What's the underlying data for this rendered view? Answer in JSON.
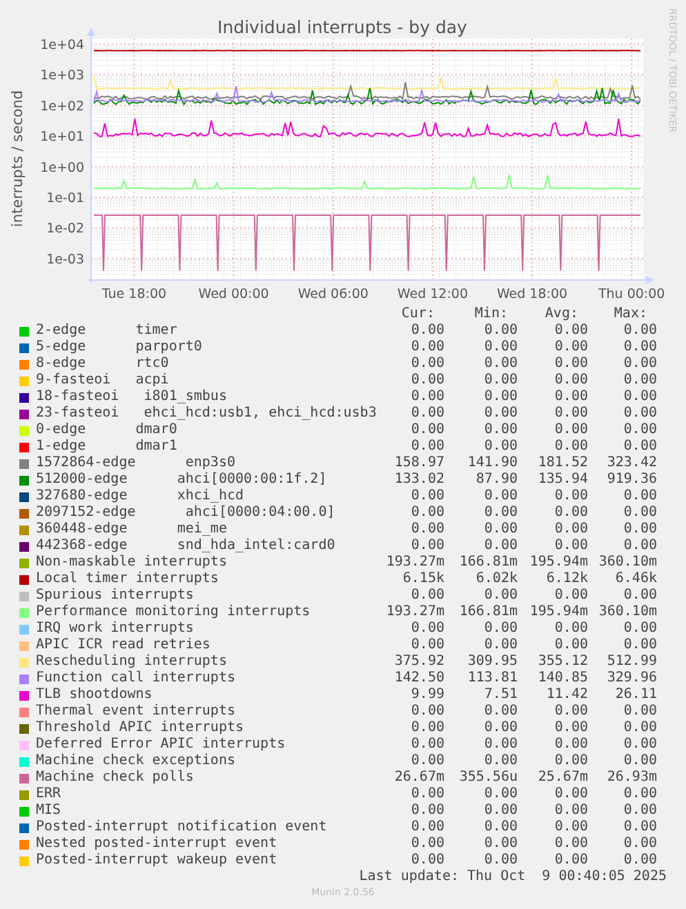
{
  "chart": {
    "title": "Individual interrupts - by day",
    "ylabel": "interrupts / second",
    "side_credit": "RRDTOOL / TOBI OETIKER",
    "y_axis_labels": [
      "1e+04",
      "1e+03",
      "1e+02",
      "1e+01",
      "1e+00",
      "1e-01",
      "1e-02",
      "1e-03"
    ],
    "x_axis_labels": [
      "Tue 18:00",
      "Wed 00:00",
      "Wed 06:00",
      "Wed 12:00",
      "Wed 18:00",
      "Thu 00:00"
    ]
  },
  "legend": {
    "columns": [
      "Cur:",
      "Min:",
      "Avg:",
      "Max:"
    ],
    "rows": [
      {
        "color": "#00cc00",
        "label": "2-edge      timer",
        "cur": "0.00",
        "min": "0.00",
        "avg": "0.00",
        "max": "0.00"
      },
      {
        "color": "#0066b3",
        "label": "5-edge      parport0",
        "cur": "0.00",
        "min": "0.00",
        "avg": "0.00",
        "max": "0.00"
      },
      {
        "color": "#ff8000",
        "label": "8-edge      rtc0",
        "cur": "0.00",
        "min": "0.00",
        "avg": "0.00",
        "max": "0.00"
      },
      {
        "color": "#ffcc00",
        "label": "9-fasteoi   acpi",
        "cur": "0.00",
        "min": "0.00",
        "avg": "0.00",
        "max": "0.00"
      },
      {
        "color": "#330099",
        "label": "18-fasteoi   i801_smbus",
        "cur": "0.00",
        "min": "0.00",
        "avg": "0.00",
        "max": "0.00"
      },
      {
        "color": "#990099",
        "label": "23-fasteoi   ehci_hcd:usb1, ehci_hcd:usb3",
        "cur": "0.00",
        "min": "0.00",
        "avg": "0.00",
        "max": "0.00"
      },
      {
        "color": "#ccff00",
        "label": "0-edge      dmar0",
        "cur": "0.00",
        "min": "0.00",
        "avg": "0.00",
        "max": "0.00"
      },
      {
        "color": "#ff0000",
        "label": "1-edge      dmar1",
        "cur": "0.00",
        "min": "0.00",
        "avg": "0.00",
        "max": "0.00"
      },
      {
        "color": "#808080",
        "label": "1572864-edge      enp3s0",
        "cur": "158.97",
        "min": "141.90",
        "avg": "181.52",
        "max": "323.42"
      },
      {
        "color": "#008f00",
        "label": "512000-edge      ahci[0000:00:1f.2]",
        "cur": "133.02",
        "min": "87.90",
        "avg": "135.94",
        "max": "919.36"
      },
      {
        "color": "#00487d",
        "label": "327680-edge      xhci_hcd",
        "cur": "0.00",
        "min": "0.00",
        "avg": "0.00",
        "max": "0.00"
      },
      {
        "color": "#b35a00",
        "label": "2097152-edge      ahci[0000:04:00.0]",
        "cur": "0.00",
        "min": "0.00",
        "avg": "0.00",
        "max": "0.00"
      },
      {
        "color": "#b38f00",
        "label": "360448-edge      mei_me",
        "cur": "0.00",
        "min": "0.00",
        "avg": "0.00",
        "max": "0.00"
      },
      {
        "color": "#6b006b",
        "label": "442368-edge      snd_hda_intel:card0",
        "cur": "0.00",
        "min": "0.00",
        "avg": "0.00",
        "max": "0.00"
      },
      {
        "color": "#8fb300",
        "label": "Non-maskable interrupts",
        "cur": "193.27m",
        "min": "166.81m",
        "avg": "195.94m",
        "max": "360.10m"
      },
      {
        "color": "#b30000",
        "label": "Local timer interrupts",
        "cur": "6.15k",
        "min": "6.02k",
        "avg": "6.12k",
        "max": "6.46k"
      },
      {
        "color": "#bebebe",
        "label": "Spurious interrupts",
        "cur": "0.00",
        "min": "0.00",
        "avg": "0.00",
        "max": "0.00"
      },
      {
        "color": "#80ff80",
        "label": "Performance monitoring interrupts",
        "cur": "193.27m",
        "min": "166.81m",
        "avg": "195.94m",
        "max": "360.10m"
      },
      {
        "color": "#80c9ff",
        "label": "IRQ work interrupts",
        "cur": "0.00",
        "min": "0.00",
        "avg": "0.00",
        "max": "0.00"
      },
      {
        "color": "#ffc080",
        "label": "APIC ICR read retries",
        "cur": "0.00",
        "min": "0.00",
        "avg": "0.00",
        "max": "0.00"
      },
      {
        "color": "#ffe680",
        "label": "Rescheduling interrupts",
        "cur": "375.92",
        "min": "309.95",
        "avg": "355.12",
        "max": "512.99"
      },
      {
        "color": "#aa80ff",
        "label": "Function call interrupts",
        "cur": "142.50",
        "min": "113.81",
        "avg": "140.85",
        "max": "329.96"
      },
      {
        "color": "#ee00cc",
        "label": "TLB shootdowns",
        "cur": "9.99",
        "min": "7.51",
        "avg": "11.42",
        "max": "26.11"
      },
      {
        "color": "#ff8080",
        "label": "Thermal event interrupts",
        "cur": "0.00",
        "min": "0.00",
        "avg": "0.00",
        "max": "0.00"
      },
      {
        "color": "#666600",
        "label": "Threshold APIC interrupts",
        "cur": "0.00",
        "min": "0.00",
        "avg": "0.00",
        "max": "0.00"
      },
      {
        "color": "#ffbfff",
        "label": "Deferred Error APIC interrupts",
        "cur": "0.00",
        "min": "0.00",
        "avg": "0.00",
        "max": "0.00"
      },
      {
        "color": "#00ffcc",
        "label": "Machine check exceptions",
        "cur": "0.00",
        "min": "0.00",
        "avg": "0.00",
        "max": "0.00"
      },
      {
        "color": "#cc6699",
        "label": "Machine check polls",
        "cur": "26.67m",
        "min": "355.56u",
        "avg": "25.67m",
        "max": "26.93m"
      },
      {
        "color": "#999900",
        "label": "ERR",
        "cur": "0.00",
        "min": "0.00",
        "avg": "0.00",
        "max": "0.00"
      },
      {
        "color": "#00cc00",
        "label": "MIS",
        "cur": "0.00",
        "min": "0.00",
        "avg": "0.00",
        "max": "0.00"
      },
      {
        "color": "#0066b3",
        "label": "Posted-interrupt notification event",
        "cur": "0.00",
        "min": "0.00",
        "avg": "0.00",
        "max": "0.00"
      },
      {
        "color": "#ff8000",
        "label": "Nested posted-interrupt event",
        "cur": "0.00",
        "min": "0.00",
        "avg": "0.00",
        "max": "0.00"
      },
      {
        "color": "#ffcc00",
        "label": "Posted-interrupt wakeup event",
        "cur": "0.00",
        "min": "0.00",
        "avg": "0.00",
        "max": "0.00"
      }
    ]
  },
  "last_update": "Last update: Thu Oct  9 00:40:05 2025",
  "footer": "Munin 2.0.56"
}
